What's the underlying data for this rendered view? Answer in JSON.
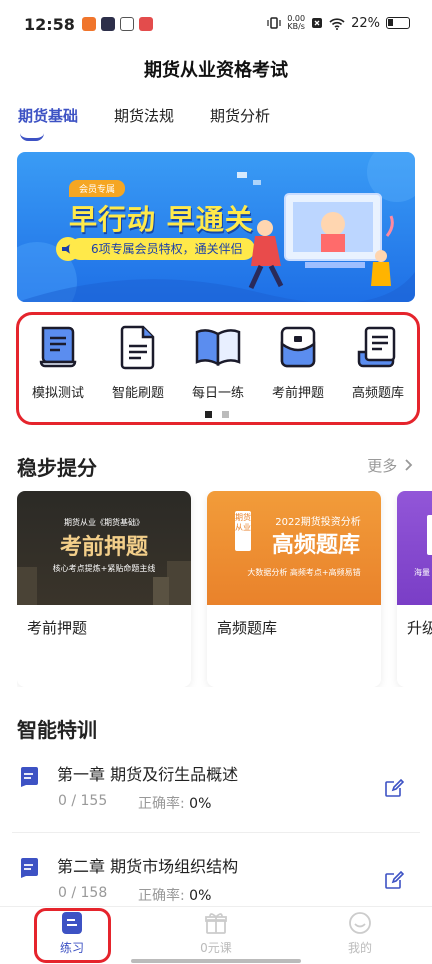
{
  "status": {
    "time": "12:58",
    "net_speed_value": "0.00",
    "net_speed_unit": "KB/s",
    "battery": "22%"
  },
  "page_title": "期货从业资格考试",
  "tabs": [
    {
      "label": "期货基础",
      "active": true
    },
    {
      "label": "期货法规",
      "active": false
    },
    {
      "label": "期货分析",
      "active": false
    }
  ],
  "banner": {
    "badge": "会员专属",
    "headline": "早行动 早通关",
    "pill": "6项专属会员特权，通关伴侣"
  },
  "quick_actions": [
    {
      "label": "模拟测试",
      "icon": "mock-test-icon"
    },
    {
      "label": "智能刷题",
      "icon": "smart-practice-icon"
    },
    {
      "label": "每日一练",
      "icon": "daily-practice-icon"
    },
    {
      "label": "考前押题",
      "icon": "pre-exam-icon"
    },
    {
      "label": "高频题库",
      "icon": "question-bank-icon"
    }
  ],
  "pager": {
    "pages": 2,
    "current": 1
  },
  "steady_section": {
    "title": "稳步提分",
    "more": "更多",
    "cards": [
      {
        "title": "考前押题",
        "img_top": "期货从业《期货基础》",
        "img_big": "考前押题",
        "img_bottom": "核心考点提炼+紧贴命题主线"
      },
      {
        "title": "高频题库",
        "img_tag": "期货从业",
        "img_top": "2022期货投资分析",
        "img_big": "高频题库",
        "img_bottom": "大数据分析 高频考点+高频易错"
      },
      {
        "title": "升级",
        "img_top": "海量"
      }
    ]
  },
  "training_section": {
    "title": "智能特训",
    "chapters": [
      {
        "title": "第一章  期货及衍生品概述",
        "progress": "0 / 155",
        "accuracy_label": "正确率:",
        "accuracy_value": "0%"
      },
      {
        "title": "第二章  期货市场组织结构",
        "progress": "0 / 158",
        "accuracy_label": "正确率:",
        "accuracy_value": "0%"
      }
    ]
  },
  "bottom_nav": [
    {
      "label": "练习",
      "icon": "practice-icon",
      "active": true
    },
    {
      "label": "0元课",
      "icon": "gift-icon",
      "active": false
    },
    {
      "label": "我的",
      "icon": "profile-icon",
      "active": false
    }
  ],
  "colors": {
    "accent": "#3d52c4",
    "highlight_box": "#e5242c",
    "muted": "#999999"
  }
}
